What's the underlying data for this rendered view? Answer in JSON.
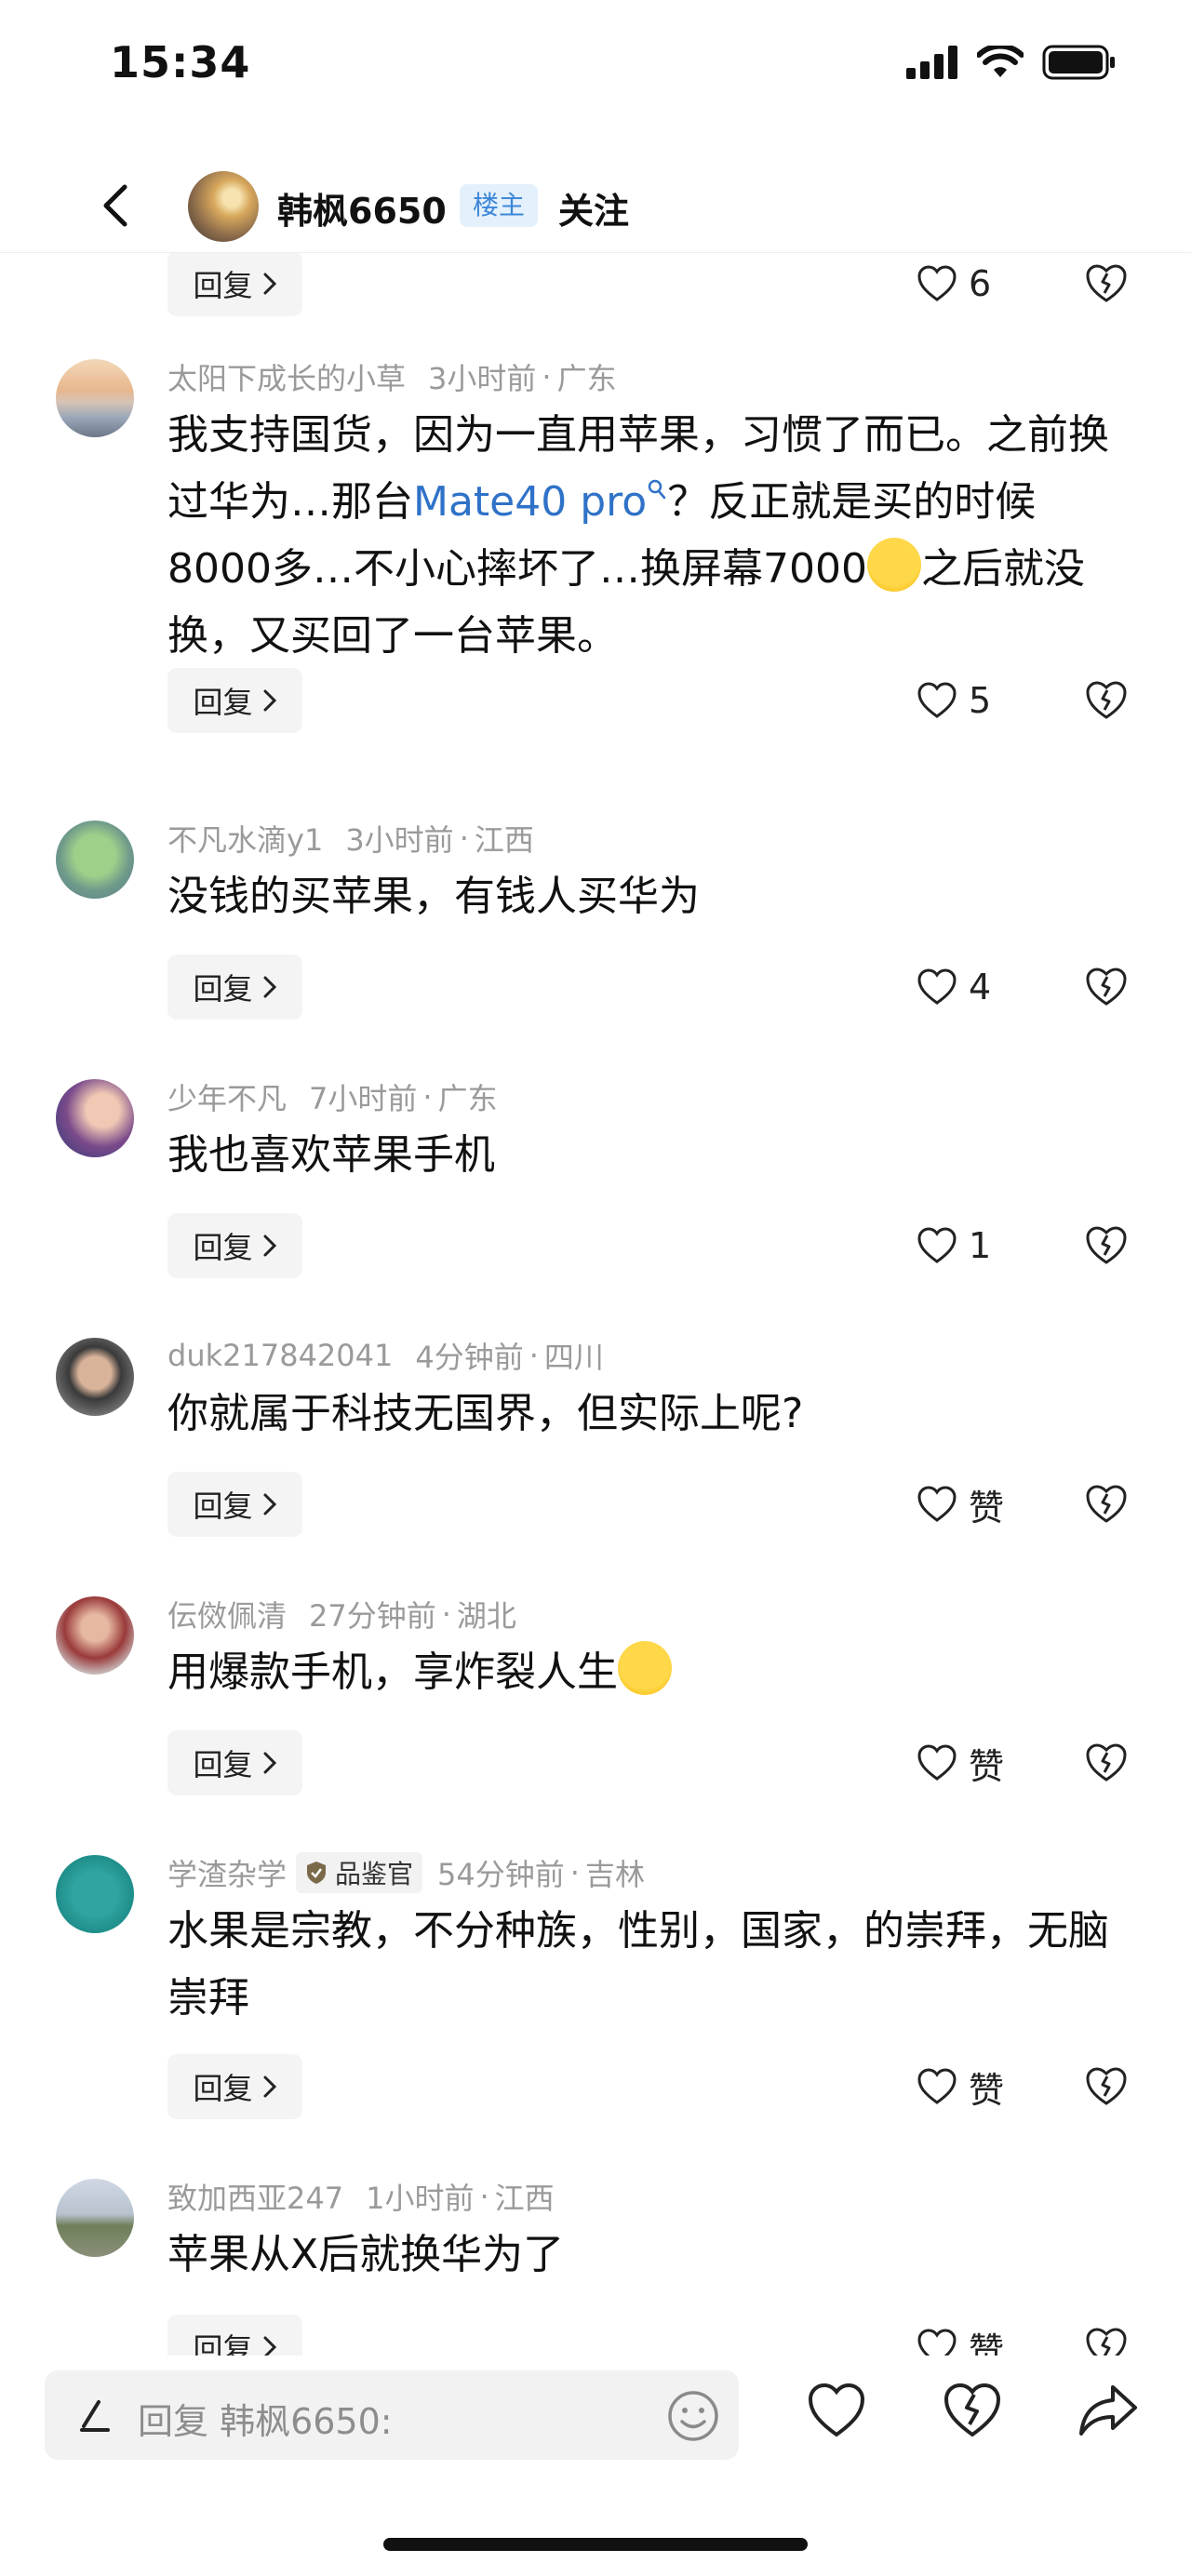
{
  "status_bar": {
    "time": "15:34"
  },
  "header": {
    "back_icon": "chevron-left-icon",
    "username": "韩枫6650",
    "owner_badge": "楼主",
    "follow_label": "关注"
  },
  "partial_top": {
    "reply_label": "回复",
    "like_count": "6"
  },
  "comments": [
    {
      "username": "太阳下成长的小草",
      "time": "3小时前",
      "location": "广东",
      "text_part1": "我支持国货，因为一直用苹果，习惯了而已。之前换过华为…那台",
      "link_text": "Mate40 pro",
      "text_part2": "？反正就是买的时候8000多…不小心摔坏了…换屏幕7000",
      "text_part3": "之后就没换，又买回了一台苹果。",
      "reply_label": "回复",
      "like_count": "5"
    },
    {
      "username": "不凡水滴y1",
      "time": "3小时前",
      "location": "江西",
      "text": "没钱的买苹果，有钱人买华为",
      "reply_label": "回复",
      "like_count": "4"
    },
    {
      "username": "少年不凡",
      "time": "7小时前",
      "location": "广东",
      "text": "我也喜欢苹果手机",
      "reply_label": "回复",
      "like_count": "1"
    },
    {
      "username": "duk217842041",
      "time": "4分钟前",
      "location": "四川",
      "text": "你就属于科技无国界，但实际上呢?",
      "reply_label": "回复",
      "like_count": "赞"
    },
    {
      "username": "伝傚佩清",
      "time": "27分钟前",
      "location": "湖北",
      "text": "用爆款手机，享炸裂人生",
      "reply_label": "回复",
      "like_count": "赞"
    },
    {
      "username": "学渣杂学",
      "badge": "品鉴官",
      "time": "54分钟前",
      "location": "吉林",
      "text": "水果是宗教，不分种族，性别，国家，的崇拜，无脑崇拜",
      "reply_label": "回复",
      "like_count": "赞"
    },
    {
      "username": "致加西亚247",
      "time": "1小时前",
      "location": "江西",
      "text": "苹果从X后就换华为了",
      "reply_label": "回复",
      "like_count": "赞"
    }
  ],
  "separator": "·",
  "bottom_bar": {
    "placeholder": "回复 韩枫6650:",
    "icons": [
      "pen-icon",
      "emoji-icon",
      "heart-icon",
      "broken-heart-icon",
      "share-icon"
    ]
  },
  "colors": {
    "link": "#2f72c8",
    "owner_badge_bg": "#e4f0fc",
    "owner_badge_text": "#3d87d8",
    "meta_text": "#9a9a9a"
  }
}
